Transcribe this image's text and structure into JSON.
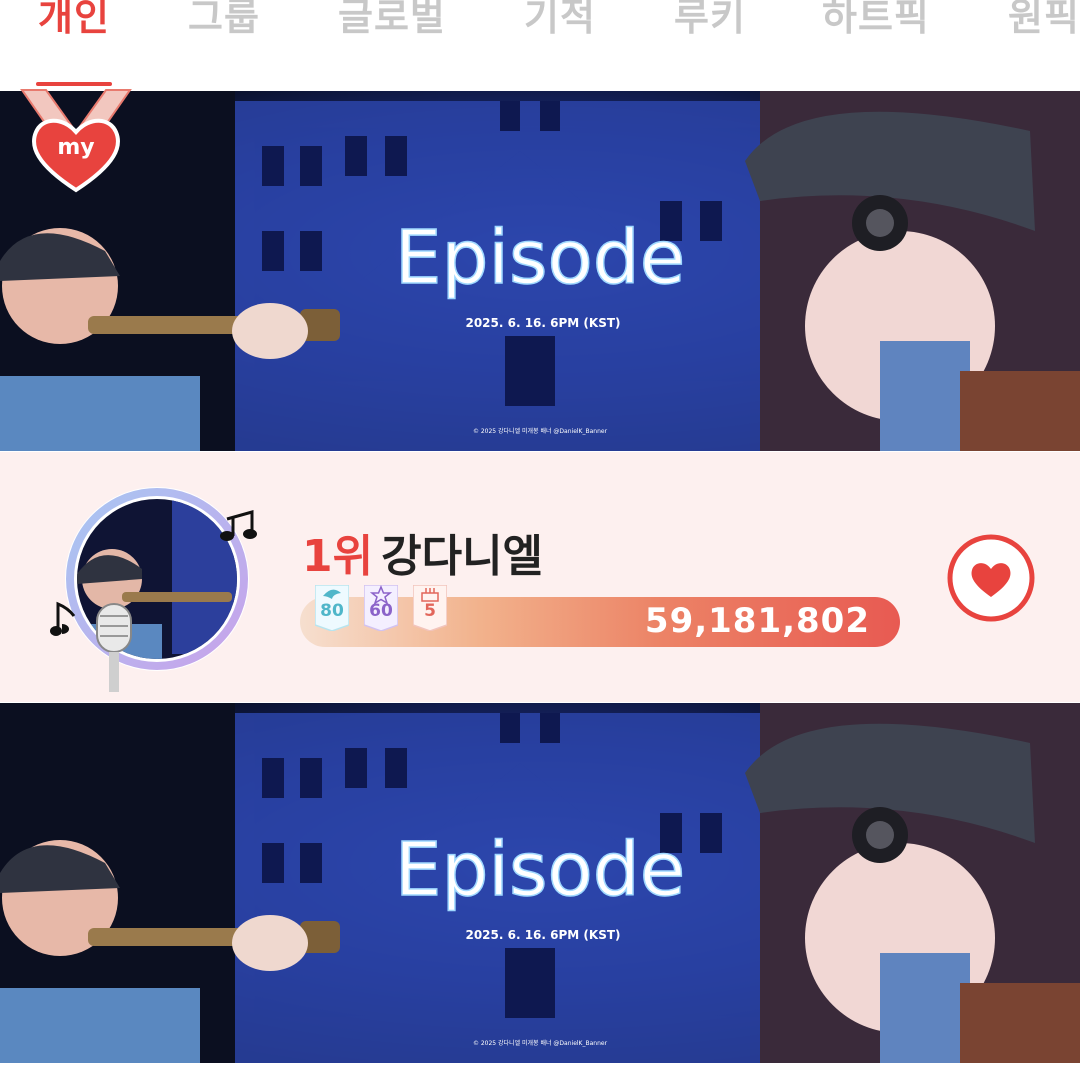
{
  "tabs": [
    {
      "label": "개인",
      "active": true
    },
    {
      "label": "그룹",
      "active": false
    },
    {
      "label": "글로벌",
      "active": false
    },
    {
      "label": "기적",
      "active": false
    },
    {
      "label": "루키",
      "active": false
    },
    {
      "label": "하트픽",
      "active": false
    },
    {
      "label": "원픽",
      "active": false
    }
  ],
  "my_badge": {
    "label": "my"
  },
  "banner": {
    "title": "Episode",
    "date": "2025. 6. 16. 6PM (KST)",
    "credit": "© 2025 강다니엘 미개봉 배너 @DanielK_Banner"
  },
  "ranking": {
    "rank": "1위",
    "name": "강다니엘",
    "badges": [
      {
        "icon": "angel-wing-icon",
        "value": "80",
        "color": "#4fb6c9"
      },
      {
        "icon": "star-icon",
        "value": "60",
        "color": "#8b63c9"
      },
      {
        "icon": "cake-icon",
        "value": "5",
        "color": "#e2665b"
      }
    ],
    "score": "59,181,802",
    "progress_fraction": 1.0,
    "heart_icon": "heart-icon"
  },
  "colors": {
    "accent": "#e8433e",
    "row_background": "#fdf0ef",
    "tab_inactive": "#c8c8c8"
  }
}
